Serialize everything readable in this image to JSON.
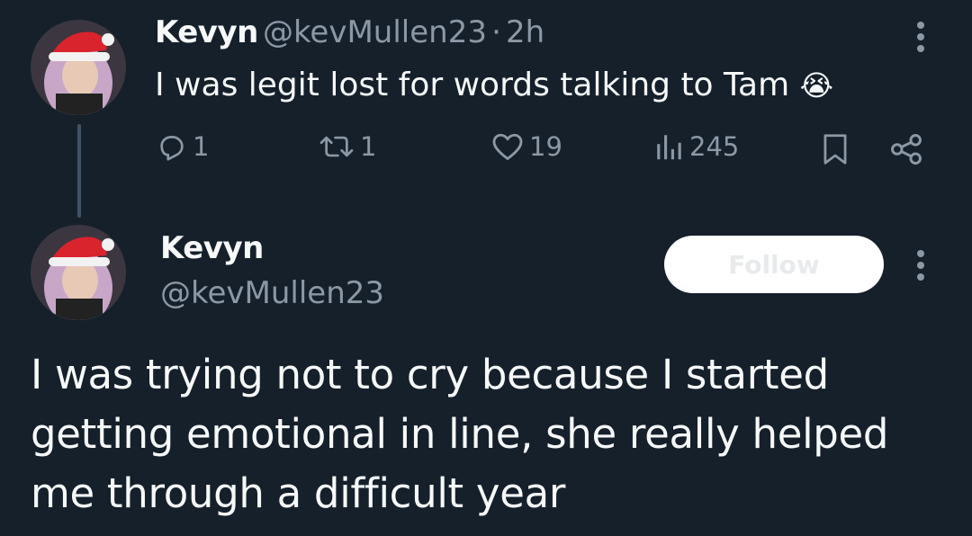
{
  "first_tweet": {
    "author_name": "Kevyn",
    "author_handle": "@kevMullen23",
    "separator": "·",
    "time": "2h",
    "text": "I was legit lost for words talking to Tam",
    "emoji": "😭",
    "actions": {
      "replies": "1",
      "retweets": "1",
      "likes": "19",
      "views": "245"
    }
  },
  "second_tweet": {
    "author_name": "Kevyn",
    "author_handle": "@kevMullen23",
    "follow_label": "Follow",
    "text": "I was trying not to cry because I started getting emotional in line, she really helped me through a difficult year"
  },
  "colors": {
    "background": "#15202b",
    "text": "#f7f9f9",
    "muted": "#8b98a5",
    "thread_line": "#425364",
    "follow_bg": "#ffffff"
  }
}
